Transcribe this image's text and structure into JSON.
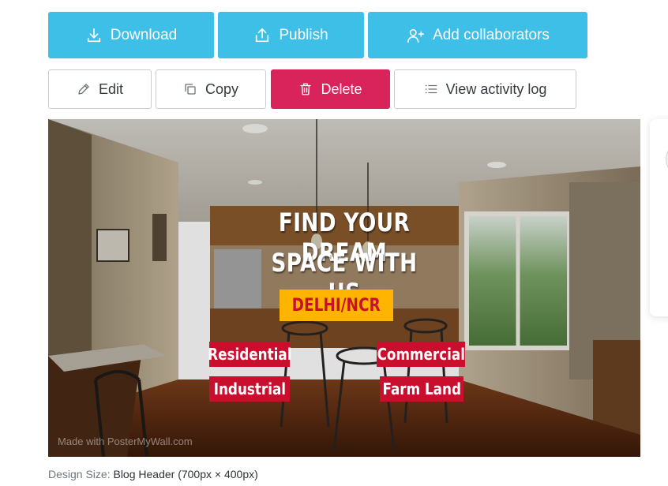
{
  "toolbar_primary": {
    "download_label": "Download",
    "publish_label": "Publish",
    "add_collaborators_label": "Add collaborators"
  },
  "toolbar_secondary": {
    "edit_label": "Edit",
    "copy_label": "Copy",
    "delete_label": "Delete",
    "activity_label": "View activity log"
  },
  "design": {
    "headline_line1": "FIND YOUR DREAM",
    "headline_line2": "SPACE WITH US",
    "location": "DELHI/NCR",
    "tags": [
      "Residential",
      "Commercial",
      "Industrial",
      "Farm Land"
    ],
    "watermark": "Made with PosterMyWall.com"
  },
  "footer": {
    "design_size_label": "Design Size:",
    "design_size_value": "Blog Header (700px × 400px)"
  },
  "colors": {
    "primary": "#3dbfe8",
    "danger": "#d8245a",
    "tag_red": "#c8102e",
    "tag_yellow": "#ffb400"
  },
  "icons": {
    "download": "download-icon",
    "publish": "upload-icon",
    "add_collaborators": "add-user-icon",
    "edit": "pencil-icon",
    "copy": "copy-icon",
    "delete": "trash-icon",
    "activity": "list-icon"
  }
}
